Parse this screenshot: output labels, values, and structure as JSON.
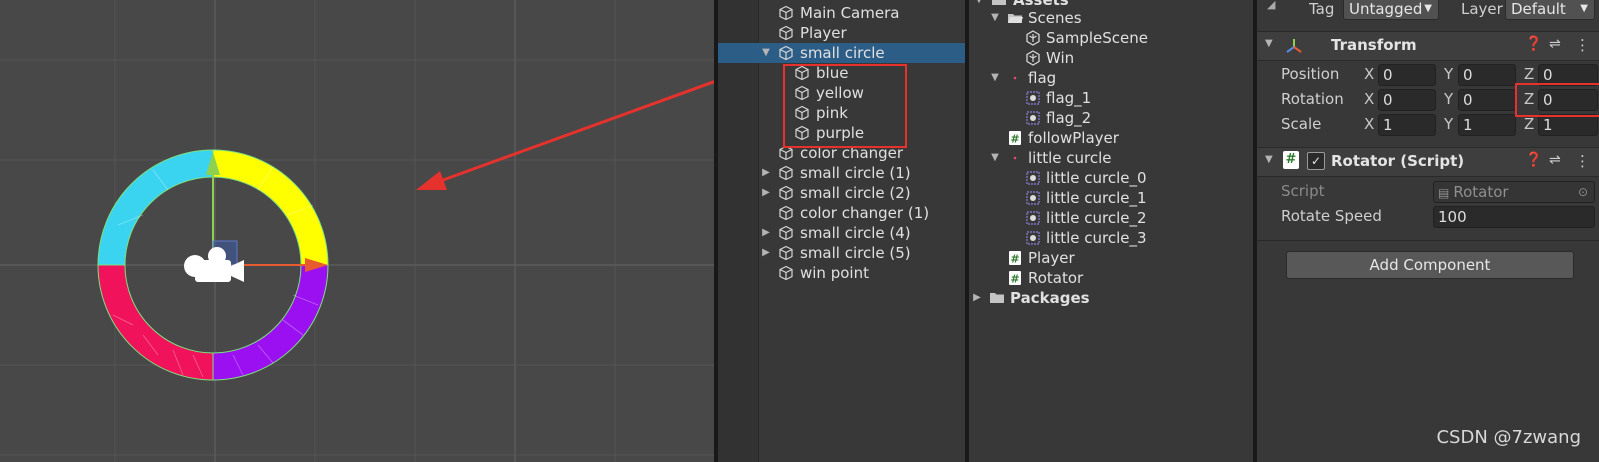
{
  "hierarchy": {
    "items": [
      {
        "label": "Main Camera",
        "icon": "cube-icon",
        "expand": "none"
      },
      {
        "label": "Player",
        "icon": "cube-icon",
        "expand": "none"
      },
      {
        "label": "small circle",
        "icon": "cube-icon",
        "expand": "open",
        "selected": true
      },
      {
        "label": "blue",
        "icon": "cube-icon",
        "expand": "none",
        "child": true
      },
      {
        "label": "yellow",
        "icon": "cube-icon",
        "expand": "none",
        "child": true
      },
      {
        "label": "pink",
        "icon": "cube-icon",
        "expand": "none",
        "child": true
      },
      {
        "label": "purple",
        "icon": "cube-icon",
        "expand": "none",
        "child": true
      },
      {
        "label": "color changer",
        "icon": "cube-icon",
        "expand": "none"
      },
      {
        "label": "small circle (1)",
        "icon": "cube-icon",
        "expand": "closed"
      },
      {
        "label": "small circle (2)",
        "icon": "cube-icon",
        "expand": "closed"
      },
      {
        "label": "color changer (1)",
        "icon": "cube-icon",
        "expand": "none"
      },
      {
        "label": "small circle (4)",
        "icon": "cube-icon",
        "expand": "closed"
      },
      {
        "label": "small circle (5)",
        "icon": "cube-icon",
        "expand": "closed"
      },
      {
        "label": "win point",
        "icon": "cube-icon",
        "expand": "none"
      }
    ]
  },
  "project": {
    "header": "Assets",
    "items": [
      {
        "label": "Scenes",
        "icon": "folder-open-icon",
        "depth": 1,
        "expand": "open"
      },
      {
        "label": "SampleScene",
        "icon": "unity-scene-icon",
        "depth": 2,
        "expand": "none"
      },
      {
        "label": "Win",
        "icon": "unity-scene-icon",
        "depth": 2,
        "expand": "none"
      },
      {
        "label": "flag",
        "icon": "sprite-dot-icon",
        "depth": 1,
        "expand": "open"
      },
      {
        "label": "flag_1",
        "icon": "sprite-icon",
        "depth": 2,
        "expand": "none"
      },
      {
        "label": "flag_2",
        "icon": "sprite-icon",
        "depth": 2,
        "expand": "none"
      },
      {
        "label": "followPlayer",
        "icon": "script-icon",
        "depth": 1,
        "expand": "none"
      },
      {
        "label": "little curcle",
        "icon": "sprite-dot-icon",
        "depth": 1,
        "expand": "open"
      },
      {
        "label": "little curcle_0",
        "icon": "sprite-icon",
        "depth": 2,
        "expand": "none"
      },
      {
        "label": "little curcle_1",
        "icon": "sprite-icon",
        "depth": 2,
        "expand": "none"
      },
      {
        "label": "little curcle_2",
        "icon": "sprite-icon",
        "depth": 2,
        "expand": "none"
      },
      {
        "label": "little curcle_3",
        "icon": "sprite-icon",
        "depth": 2,
        "expand": "none"
      },
      {
        "label": "Player",
        "icon": "script-icon",
        "depth": 1,
        "expand": "none"
      },
      {
        "label": "Rotator",
        "icon": "script-icon",
        "depth": 1,
        "expand": "none"
      },
      {
        "label": "Packages",
        "icon": "folder-icon",
        "depth": 0,
        "expand": "closed",
        "bold": true
      }
    ]
  },
  "inspector": {
    "tag_label": "Tag",
    "tag_value": "Untagged",
    "layer_label": "Layer",
    "layer_value": "Default",
    "transform": {
      "title": "Transform",
      "position_label": "Position",
      "rotation_label": "Rotation",
      "scale_label": "Scale",
      "axis_x": "X",
      "axis_y": "Y",
      "axis_z": "Z",
      "position": [
        "0",
        "0",
        "0"
      ],
      "rotation": [
        "0",
        "0",
        "0"
      ],
      "scale": [
        "1",
        "1",
        "1"
      ]
    },
    "rotator": {
      "title": "Rotator (Script)",
      "script_label": "Script",
      "script_value": "Rotator",
      "speed_label": "Rotate Speed",
      "speed_value": "100"
    },
    "add_component": "Add Component"
  },
  "watermark": "CSDN @7zwang",
  "colors": {
    "ring_cyan": "#3ad4f0",
    "ring_yellow": "#ffff00",
    "ring_magenta": "#f0125a",
    "ring_purple": "#9b10f0",
    "highlight_red": "#e5322d",
    "selection": "#2c5d87"
  }
}
